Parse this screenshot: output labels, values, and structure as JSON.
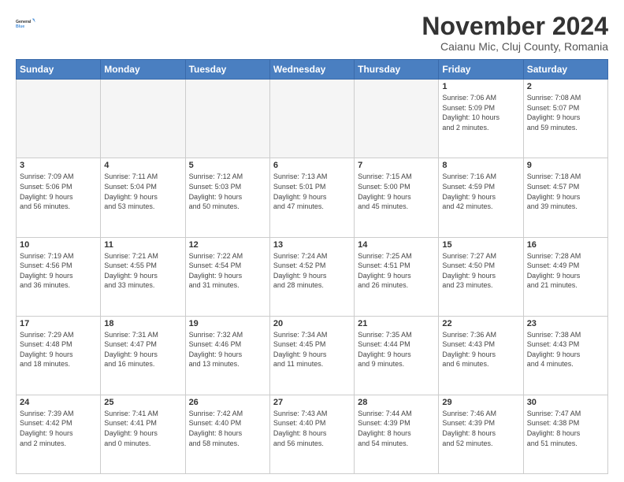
{
  "logo": {
    "general": "General",
    "blue": "Blue"
  },
  "header": {
    "month": "November 2024",
    "location": "Caianu Mic, Cluj County, Romania"
  },
  "weekdays": [
    "Sunday",
    "Monday",
    "Tuesday",
    "Wednesday",
    "Thursday",
    "Friday",
    "Saturday"
  ],
  "weeks": [
    [
      {
        "day": "",
        "info": ""
      },
      {
        "day": "",
        "info": ""
      },
      {
        "day": "",
        "info": ""
      },
      {
        "day": "",
        "info": ""
      },
      {
        "day": "",
        "info": ""
      },
      {
        "day": "1",
        "info": "Sunrise: 7:06 AM\nSunset: 5:09 PM\nDaylight: 10 hours\nand 2 minutes."
      },
      {
        "day": "2",
        "info": "Sunrise: 7:08 AM\nSunset: 5:07 PM\nDaylight: 9 hours\nand 59 minutes."
      }
    ],
    [
      {
        "day": "3",
        "info": "Sunrise: 7:09 AM\nSunset: 5:06 PM\nDaylight: 9 hours\nand 56 minutes."
      },
      {
        "day": "4",
        "info": "Sunrise: 7:11 AM\nSunset: 5:04 PM\nDaylight: 9 hours\nand 53 minutes."
      },
      {
        "day": "5",
        "info": "Sunrise: 7:12 AM\nSunset: 5:03 PM\nDaylight: 9 hours\nand 50 minutes."
      },
      {
        "day": "6",
        "info": "Sunrise: 7:13 AM\nSunset: 5:01 PM\nDaylight: 9 hours\nand 47 minutes."
      },
      {
        "day": "7",
        "info": "Sunrise: 7:15 AM\nSunset: 5:00 PM\nDaylight: 9 hours\nand 45 minutes."
      },
      {
        "day": "8",
        "info": "Sunrise: 7:16 AM\nSunset: 4:59 PM\nDaylight: 9 hours\nand 42 minutes."
      },
      {
        "day": "9",
        "info": "Sunrise: 7:18 AM\nSunset: 4:57 PM\nDaylight: 9 hours\nand 39 minutes."
      }
    ],
    [
      {
        "day": "10",
        "info": "Sunrise: 7:19 AM\nSunset: 4:56 PM\nDaylight: 9 hours\nand 36 minutes."
      },
      {
        "day": "11",
        "info": "Sunrise: 7:21 AM\nSunset: 4:55 PM\nDaylight: 9 hours\nand 33 minutes."
      },
      {
        "day": "12",
        "info": "Sunrise: 7:22 AM\nSunset: 4:54 PM\nDaylight: 9 hours\nand 31 minutes."
      },
      {
        "day": "13",
        "info": "Sunrise: 7:24 AM\nSunset: 4:52 PM\nDaylight: 9 hours\nand 28 minutes."
      },
      {
        "day": "14",
        "info": "Sunrise: 7:25 AM\nSunset: 4:51 PM\nDaylight: 9 hours\nand 26 minutes."
      },
      {
        "day": "15",
        "info": "Sunrise: 7:27 AM\nSunset: 4:50 PM\nDaylight: 9 hours\nand 23 minutes."
      },
      {
        "day": "16",
        "info": "Sunrise: 7:28 AM\nSunset: 4:49 PM\nDaylight: 9 hours\nand 21 minutes."
      }
    ],
    [
      {
        "day": "17",
        "info": "Sunrise: 7:29 AM\nSunset: 4:48 PM\nDaylight: 9 hours\nand 18 minutes."
      },
      {
        "day": "18",
        "info": "Sunrise: 7:31 AM\nSunset: 4:47 PM\nDaylight: 9 hours\nand 16 minutes."
      },
      {
        "day": "19",
        "info": "Sunrise: 7:32 AM\nSunset: 4:46 PM\nDaylight: 9 hours\nand 13 minutes."
      },
      {
        "day": "20",
        "info": "Sunrise: 7:34 AM\nSunset: 4:45 PM\nDaylight: 9 hours\nand 11 minutes."
      },
      {
        "day": "21",
        "info": "Sunrise: 7:35 AM\nSunset: 4:44 PM\nDaylight: 9 hours\nand 9 minutes."
      },
      {
        "day": "22",
        "info": "Sunrise: 7:36 AM\nSunset: 4:43 PM\nDaylight: 9 hours\nand 6 minutes."
      },
      {
        "day": "23",
        "info": "Sunrise: 7:38 AM\nSunset: 4:43 PM\nDaylight: 9 hours\nand 4 minutes."
      }
    ],
    [
      {
        "day": "24",
        "info": "Sunrise: 7:39 AM\nSunset: 4:42 PM\nDaylight: 9 hours\nand 2 minutes."
      },
      {
        "day": "25",
        "info": "Sunrise: 7:41 AM\nSunset: 4:41 PM\nDaylight: 9 hours\nand 0 minutes."
      },
      {
        "day": "26",
        "info": "Sunrise: 7:42 AM\nSunset: 4:40 PM\nDaylight: 8 hours\nand 58 minutes."
      },
      {
        "day": "27",
        "info": "Sunrise: 7:43 AM\nSunset: 4:40 PM\nDaylight: 8 hours\nand 56 minutes."
      },
      {
        "day": "28",
        "info": "Sunrise: 7:44 AM\nSunset: 4:39 PM\nDaylight: 8 hours\nand 54 minutes."
      },
      {
        "day": "29",
        "info": "Sunrise: 7:46 AM\nSunset: 4:39 PM\nDaylight: 8 hours\nand 52 minutes."
      },
      {
        "day": "30",
        "info": "Sunrise: 7:47 AM\nSunset: 4:38 PM\nDaylight: 8 hours\nand 51 minutes."
      }
    ]
  ]
}
